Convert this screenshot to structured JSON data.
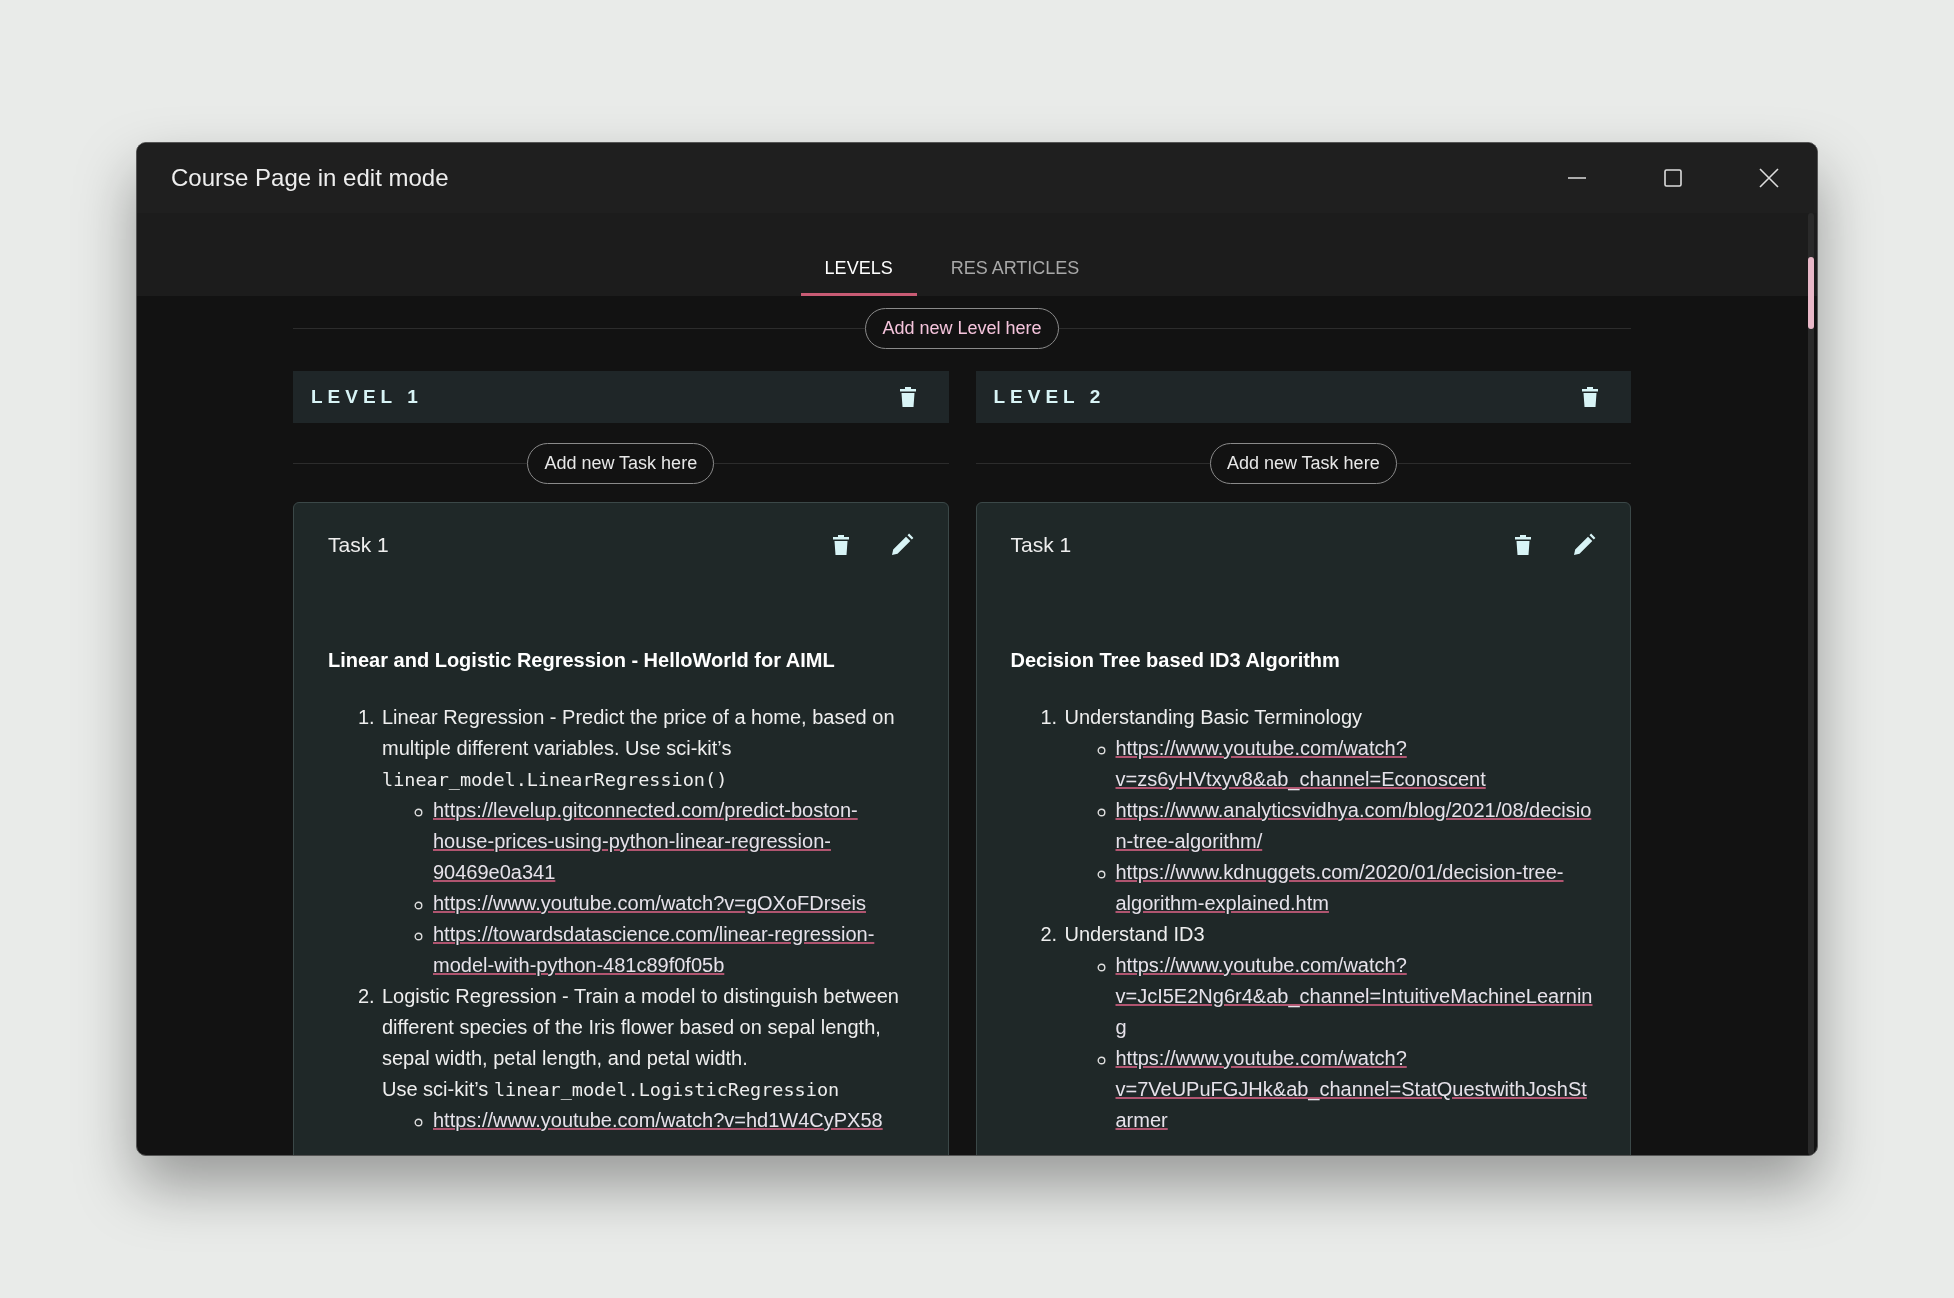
{
  "window": {
    "title": "Course Page in edit mode"
  },
  "tabs": [
    {
      "label": "LEVELS",
      "selected": true
    },
    {
      "label": "RES ARTICLES",
      "selected": false
    }
  ],
  "add_level_button": "Add new Level here",
  "levels": [
    {
      "title": "LEVEL 1",
      "add_task_button": "Add new Task here",
      "tasks": [
        {
          "title": "Task 1",
          "heading": "Linear and Logistic Regression - HelloWorld for AIML",
          "items": [
            {
              "number": "1.",
              "lines": [
                [
                  {
                    "kind": "text",
                    "text": "Linear Regression - Predict the price of a home, based on multiple different variables. Use sci-kit’s "
                  },
                  {
                    "kind": "code",
                    "text": "linear_model.LinearRegression()"
                  }
                ]
              ],
              "links": [
                "https://levelup.gitconnected.com/predict-boston-house-prices-using-python-linear-regression-90469e0a341",
                "https://www.youtube.com/watch?v=gOXoFDrseis",
                "https://towardsdatascience.com/linear-regression-model-with-python-481c89f0f05b"
              ]
            },
            {
              "number": "2.",
              "lines": [
                [
                  {
                    "kind": "text",
                    "text": "Logistic Regression - Train a model to distinguish between different species of the Iris flower based on sepal length, sepal width, petal length, and petal width."
                  }
                ],
                [
                  {
                    "kind": "text",
                    "text": "Use sci-kit’s "
                  },
                  {
                    "kind": "code",
                    "text": "linear_model.LogisticRegression"
                  }
                ]
              ],
              "links": [
                "https://www.youtube.com/watch?v=hd1W4CyPX58"
              ]
            }
          ]
        }
      ]
    },
    {
      "title": "LEVEL 2",
      "add_task_button": "Add new Task here",
      "tasks": [
        {
          "title": "Task 1",
          "heading": "Decision Tree based ID3 Algorithm",
          "items": [
            {
              "number": "1.",
              "lines": [
                [
                  {
                    "kind": "text",
                    "text": "Understanding Basic Terminology"
                  }
                ]
              ],
              "links": [
                "https://www.youtube.com/watch?v=zs6yHVtxyv8&ab_channel=Econoscent",
                "https://www.analyticsvidhya.com/blog/2021/08/decision-tree-algorithm/",
                "https://www.kdnuggets.com/2020/01/decision-tree-algorithm-explained.htm"
              ]
            },
            {
              "number": "2.",
              "lines": [
                [
                  {
                    "kind": "text",
                    "text": "Understand ID3"
                  }
                ]
              ],
              "links": [
                "https://www.youtube.com/watch?v=JcI5E2Ng6r4&ab_channel=IntuitiveMachineLearning",
                "https://www.youtube.com/watch?v=7VeUPuFGJHk&ab_channel=StatQuestwithJoshStarmer"
              ]
            }
          ]
        }
      ]
    }
  ]
}
